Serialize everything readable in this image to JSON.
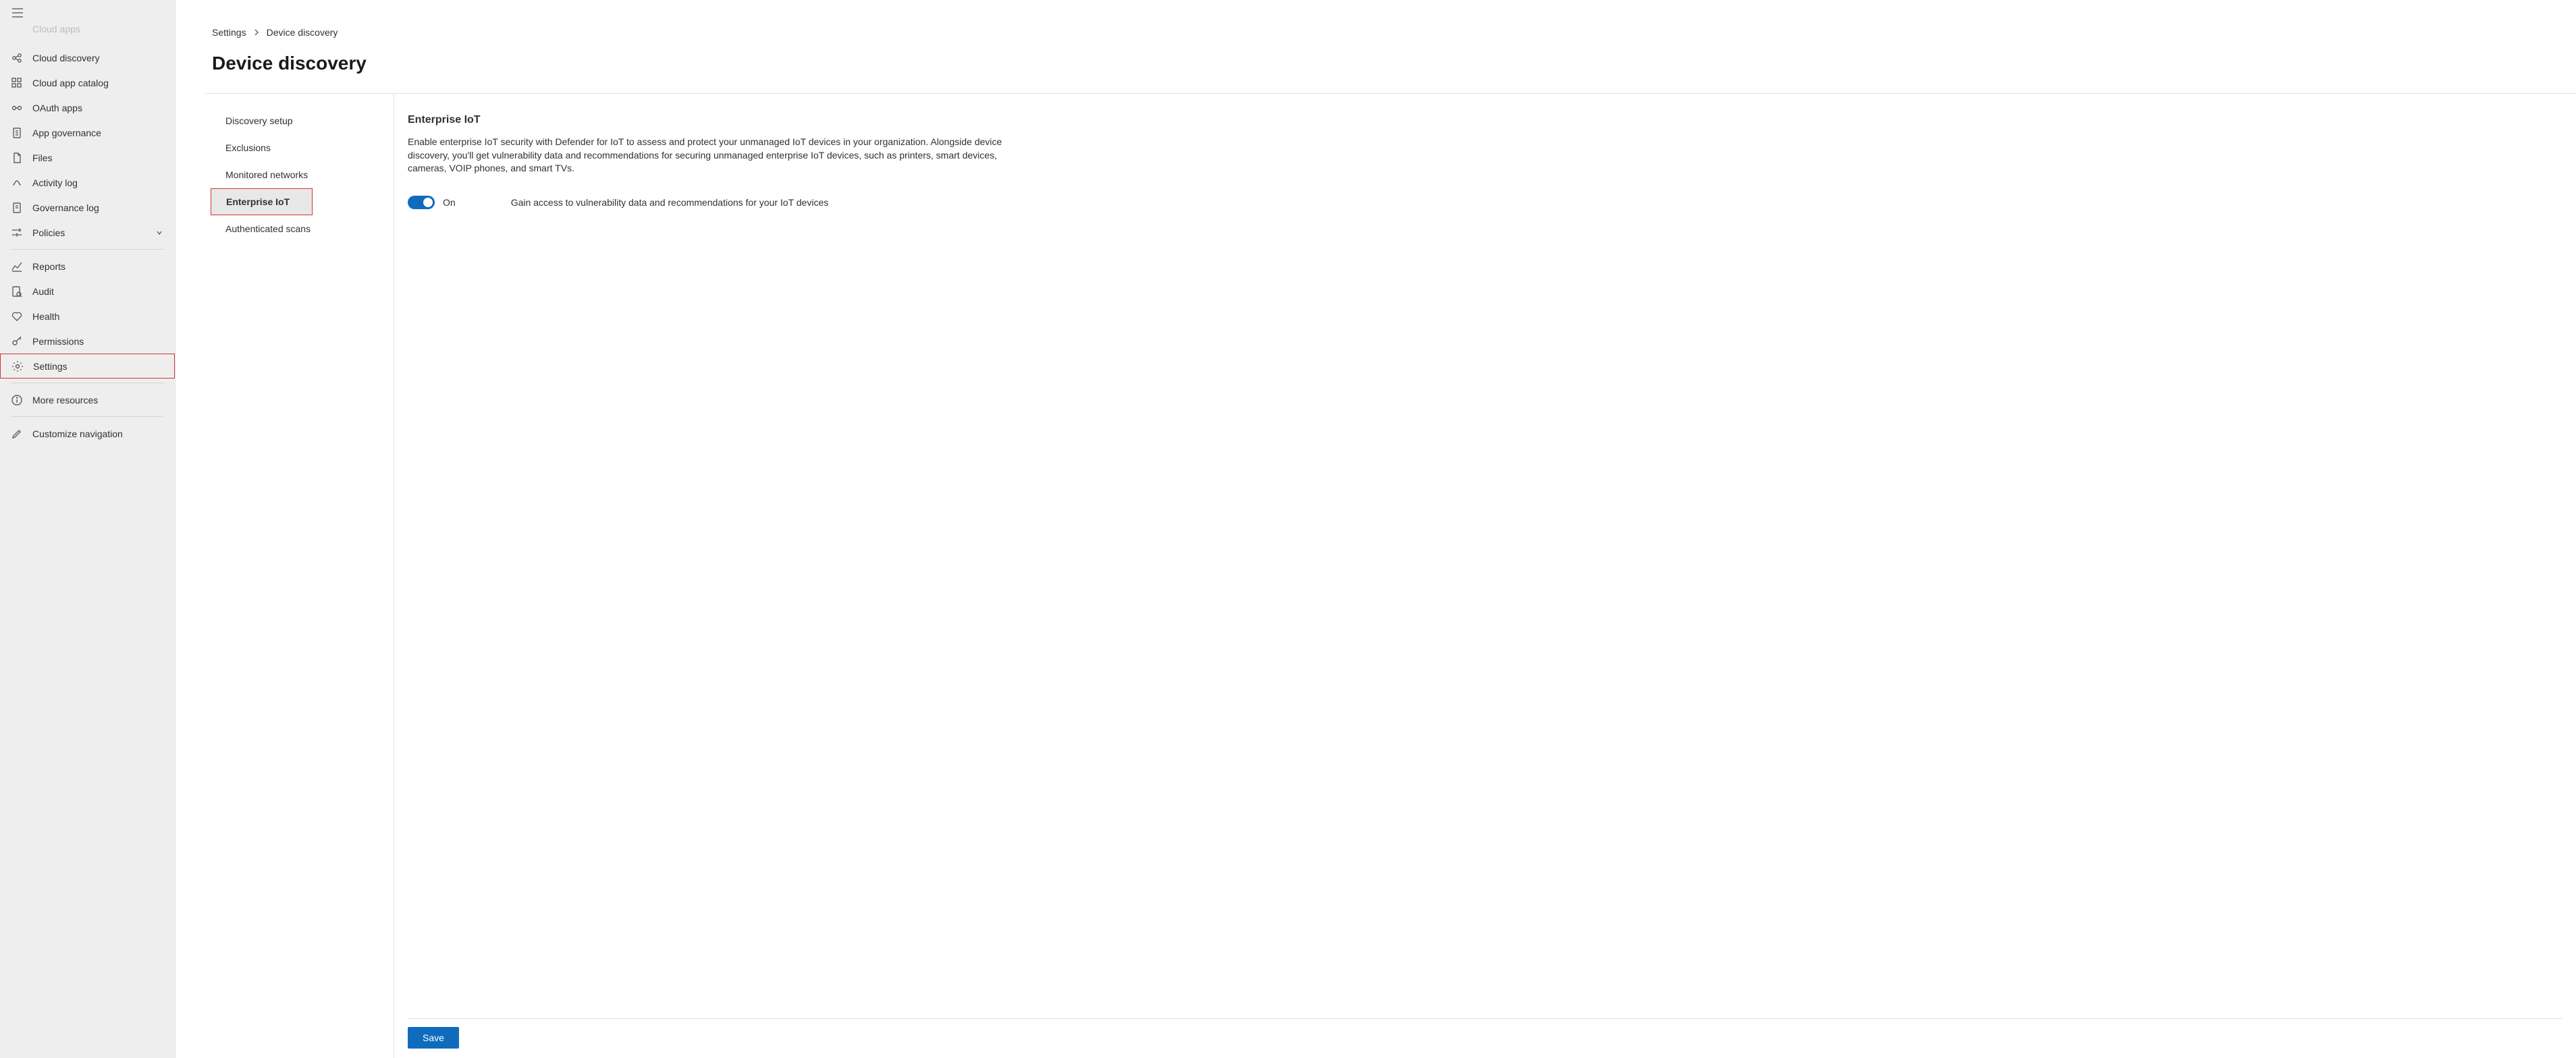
{
  "sidebar": {
    "items": [
      {
        "label": "Cloud apps",
        "icon": "cloud-apps-icon",
        "truncated": true
      },
      {
        "label": "Cloud discovery",
        "icon": "cloud-discovery-icon"
      },
      {
        "label": "Cloud app catalog",
        "icon": "app-catalog-icon"
      },
      {
        "label": "OAuth apps",
        "icon": "oauth-icon"
      },
      {
        "label": "App governance",
        "icon": "governance-icon"
      },
      {
        "label": "Files",
        "icon": "files-icon"
      },
      {
        "label": "Activity log",
        "icon": "activity-icon"
      },
      {
        "label": "Governance log",
        "icon": "governance-log-icon"
      },
      {
        "label": "Policies",
        "icon": "policies-icon",
        "expandable": true
      }
    ],
    "group2": [
      {
        "label": "Reports",
        "icon": "reports-icon"
      },
      {
        "label": "Audit",
        "icon": "audit-icon"
      },
      {
        "label": "Health",
        "icon": "health-icon"
      },
      {
        "label": "Permissions",
        "icon": "permissions-icon"
      },
      {
        "label": "Settings",
        "icon": "settings-icon",
        "highlighted": true
      }
    ],
    "group3": [
      {
        "label": "More resources",
        "icon": "info-icon"
      }
    ],
    "group4": [
      {
        "label": "Customize navigation",
        "icon": "edit-icon"
      }
    ]
  },
  "breadcrumb": {
    "root": "Settings",
    "current": "Device discovery"
  },
  "page": {
    "title": "Device discovery"
  },
  "subnav": {
    "items": [
      {
        "label": "Discovery setup"
      },
      {
        "label": "Exclusions"
      },
      {
        "label": "Monitored networks"
      },
      {
        "label": "Enterprise IoT",
        "selected": true,
        "highlighted": true
      },
      {
        "label": "Authenticated scans"
      }
    ]
  },
  "detail": {
    "title": "Enterprise IoT",
    "description": "Enable enterprise IoT security with Defender for IoT to assess and protect your unmanaged IoT devices in your organization. Alongside device discovery, you'll get vulnerability data and recommendations for securing unmanaged enterprise IoT devices, such as printers, smart devices, cameras, VOIP phones, and smart TVs.",
    "toggle_state": "On",
    "toggle_hint": "Gain access to vulnerability data and recommendations for your IoT devices",
    "save_label": "Save"
  }
}
